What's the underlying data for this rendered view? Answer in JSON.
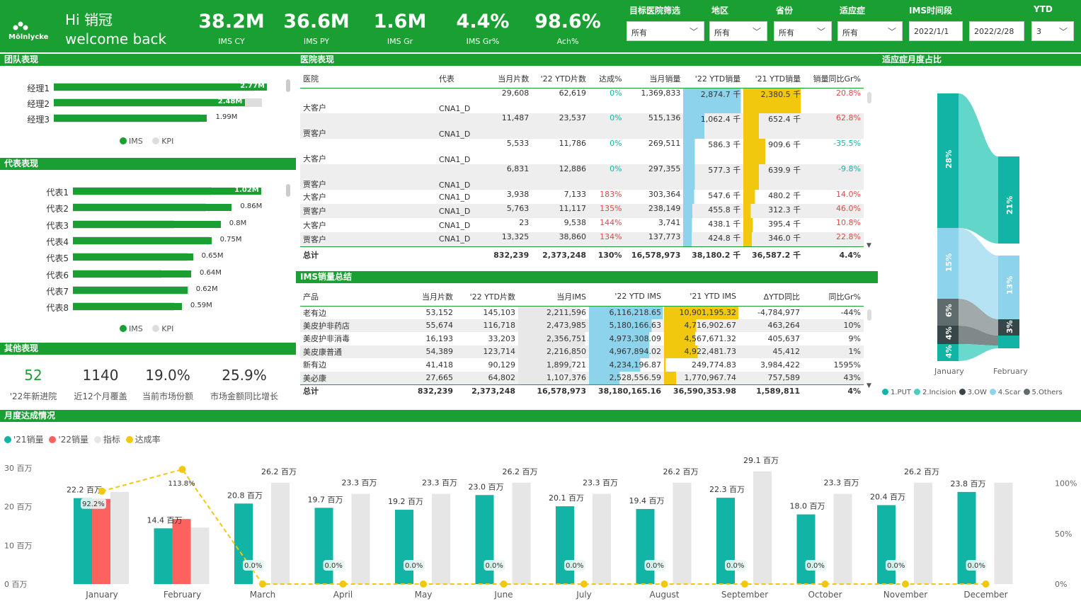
{
  "header": {
    "greeting": "Hi  销冠",
    "welcome": "welcome back",
    "logo_text": "Mölnlycke",
    "kpis": [
      {
        "value": "38.2M",
        "label": "IMS CY"
      },
      {
        "value": "36.6M",
        "label": "IMS PY"
      },
      {
        "value": "1.6M",
        "label": "IMS Gr"
      },
      {
        "value": "4.4%",
        "label": "IMS Gr%"
      },
      {
        "value": "98.6%",
        "label": "Ach%"
      }
    ],
    "filters": [
      {
        "label": "目标医院筛选",
        "value": "所有"
      },
      {
        "label": "地区",
        "value": "所有"
      },
      {
        "label": "省份",
        "value": "所有"
      },
      {
        "label": "适应症",
        "value": "所有"
      },
      {
        "label": "IMS时间段",
        "value": "2022/1/1",
        "value2": "2022/2/28"
      },
      {
        "label": "YTD",
        "value": "3"
      }
    ]
  },
  "sections": {
    "team": "团队表现",
    "rep": "代表表现",
    "other": "其他表现",
    "hospital": "医院表现",
    "ims": "IMS销量总结",
    "indication": "适应症月度占比",
    "monthly": "月度达成情况"
  },
  "team": {
    "legend": [
      "IMS",
      "KPI"
    ],
    "rows": [
      {
        "name": "经理1",
        "ims": 2.77,
        "kpi": 2.6,
        "label": "2.77M"
      },
      {
        "name": "经理2",
        "ims": 2.48,
        "kpi": 2.7,
        "label": "2.48M"
      },
      {
        "name": "经理3",
        "ims": 1.99,
        "kpi": 1.9,
        "label": "1.99M"
      }
    ]
  },
  "reps": {
    "legend": [
      "IMS",
      "KPI"
    ],
    "rows": [
      {
        "name": "代表1",
        "ims": 1.02,
        "kpi": 0.75,
        "label": "1.02M"
      },
      {
        "name": "代表2",
        "ims": 0.86,
        "kpi": 0.72,
        "label": "0.86M"
      },
      {
        "name": "代表3",
        "ims": 0.8,
        "kpi": 0.55,
        "label": "0.8M"
      },
      {
        "name": "代表4",
        "ims": 0.75,
        "kpi": 0.74,
        "label": "0.75M"
      },
      {
        "name": "代表5",
        "ims": 0.65,
        "kpi": 0.62,
        "label": "0.65M"
      },
      {
        "name": "代表6",
        "ims": 0.64,
        "kpi": 0.48,
        "label": "0.64M"
      },
      {
        "name": "代表7",
        "ims": 0.62,
        "kpi": 0.63,
        "label": "0.62M"
      },
      {
        "name": "代表8",
        "ims": 0.59,
        "kpi": 0.55,
        "label": "0.59M"
      }
    ]
  },
  "other": [
    {
      "value": "52",
      "label": "'22年新进院",
      "accent": "#1aa032"
    },
    {
      "value": "1140",
      "label": "近12个月覆盖"
    },
    {
      "value": "19.0%",
      "label": "当前市场份额"
    },
    {
      "value": "25.9%",
      "label": "市场金额同比增长"
    }
  ],
  "hospital": {
    "columns": [
      "医院",
      "代表",
      "当月片数",
      "'22 YTD片数",
      "达成%",
      "当月销量",
      "'22 YTD销量",
      "'21 YTD销量",
      "销量同比Gr%"
    ],
    "rows": [
      [
        "大客户",
        "CNA1_D",
        "29,608",
        "62,619",
        "0%",
        "1,369,833",
        "2,874.7 千",
        "2,380.5 千",
        "20.8%"
      ],
      [
        "贾客户",
        "CNA1_D",
        "11,487",
        "23,537",
        "0%",
        "515,136",
        "1,062.4 千",
        "652.4 千",
        "62.8%"
      ],
      [
        "大客户",
        "CNA1_D",
        "5,533",
        "11,786",
        "0%",
        "269,511",
        "586.3 千",
        "909.6 千",
        "-35.5%"
      ],
      [
        "贾客户",
        "CNA1_D",
        "6,831",
        "12,886",
        "0%",
        "297,355",
        "577.3 千",
        "639.9 千",
        "-9.8%"
      ],
      [
        "大客户",
        "CNA1_D",
        "3,938",
        "7,133",
        "183%",
        "303,364",
        "547.6 千",
        "480.2 千",
        "14.0%"
      ],
      [
        "贾客户",
        "CNA1_D",
        "5,763",
        "11,117",
        "135%",
        "238,149",
        "455.8 千",
        "312.3 千",
        "46.0%"
      ],
      [
        "大客户",
        "CNA1_D",
        "23",
        "9,538",
        "144%",
        "3,741",
        "438.1 千",
        "395.4 千",
        "10.8%"
      ],
      [
        "贾客户",
        "CNA1_D",
        "13,325",
        "38,860",
        "134%",
        "137,773",
        "424.8 千",
        "346.0 千",
        "22.8%"
      ]
    ],
    "bar22": [
      2874.7,
      1062.4,
      586.3,
      577.3,
      547.6,
      455.8,
      438.1,
      424.8
    ],
    "bar21": [
      2380.5,
      652.4,
      909.6,
      639.9,
      480.2,
      312.3,
      395.4,
      346.0
    ],
    "total": [
      "总计",
      "",
      "832,239",
      "2,373,248",
      "130%",
      "16,578,973",
      "38,180.2 千",
      "36,587.2 千",
      "4.4%"
    ]
  },
  "ims": {
    "columns": [
      "产品",
      "当月片数",
      "'22 YTD片数",
      "当月IMS",
      "'22 YTD IMS",
      "'21 YTD IMS",
      "ΔYTD同比",
      "同比Gr%"
    ],
    "rows": [
      [
        "老有边",
        "53,152",
        "145,103",
        "2,211,596",
        "6,116,218.65",
        "10,901,195.32",
        "-4,784,977",
        "-44%"
      ],
      [
        "美皮护非药店",
        "55,674",
        "116,718",
        "2,473,985",
        "5,180,166.63",
        "4,716,902.67",
        "463,264",
        "10%"
      ],
      [
        "美皮护非消毒",
        "16,193",
        "33,203",
        "2,356,751",
        "4,973,308.09",
        "4,567,671.32",
        "405,637",
        "9%"
      ],
      [
        "美皮康普通",
        "54,389",
        "123,714",
        "2,216,850",
        "4,967,894.02",
        "4,922,481.73",
        "45,412",
        "1%"
      ],
      [
        "新有边",
        "41,418",
        "90,129",
        "1,899,721",
        "4,234,196.87",
        "249,774.83",
        "3,984,422",
        "1595%"
      ],
      [
        "美必康",
        "27,665",
        "64,802",
        "1,107,376",
        "2,528,556.59",
        "1,770,967.74",
        "757,589",
        "43%"
      ]
    ],
    "bar_month": [
      2211596,
      2473985,
      2356751,
      2216850,
      1899721,
      1107376
    ],
    "bar22": [
      6116218.65,
      5180166.63,
      4973308.09,
      4967894.02,
      4234196.87,
      2528556.59
    ],
    "bar21": [
      10901195.32,
      4716902.67,
      4567671.32,
      4922481.73,
      249774.83,
      1770967.74
    ],
    "total": [
      "总计",
      "832,239",
      "2,373,248",
      "16,578,973",
      "38,180,165.16",
      "36,590,353.98",
      "1,589,811",
      "4%"
    ]
  },
  "indication": {
    "months": [
      "January",
      "February"
    ],
    "legend": [
      {
        "name": "1.PUT",
        "color": "#12b5a5"
      },
      {
        "name": "2.Incision",
        "color": "#45cfc0"
      },
      {
        "name": "3.OW",
        "color": "#374649"
      },
      {
        "name": "4.Scar",
        "color": "#8dd3ec"
      },
      {
        "name": "5.Others",
        "color": "#5f6b6d"
      }
    ],
    "jan_labels": [
      "28%",
      "15%",
      "6%",
      "4%",
      "4%"
    ],
    "feb_labels": [
      "21%",
      "13%",
      "3%"
    ]
  },
  "chart_data": {
    "type": "bar",
    "categories": [
      "January",
      "February",
      "March",
      "April",
      "May",
      "June",
      "July",
      "August",
      "September",
      "October",
      "November",
      "December"
    ],
    "series": [
      {
        "name": "'21销量",
        "color": "#12b5a5",
        "values": [
          22.2,
          14.4,
          20.8,
          19.7,
          19.2,
          23.0,
          20.1,
          19.4,
          22.3,
          18.0,
          20.4,
          23.8
        ]
      },
      {
        "name": "'22销量",
        "color": "#fd625e",
        "values": [
          22.0,
          16.8,
          null,
          null,
          null,
          null,
          null,
          null,
          null,
          null,
          null,
          null
        ]
      },
      {
        "name": "指标",
        "color": "#e6e6e6",
        "values": [
          23.8,
          14.6,
          26.2,
          23.3,
          23.3,
          26.2,
          23.3,
          26.2,
          29.1,
          23.3,
          26.2,
          26.2
        ]
      },
      {
        "name": "达成率",
        "color": "#f2c80f",
        "values": [
          92.2,
          113.8,
          0,
          0,
          0,
          0,
          0,
          0,
          0,
          0,
          0,
          0
        ]
      }
    ],
    "value_labels": [
      "22.2 百万",
      "14.4 百万",
      "20.8 百万",
      "19.7 百万",
      "19.2 百万",
      "23.0 百万",
      "20.1 百万",
      "19.4 百万",
      "22.3 百万",
      "18.0 百万",
      "20.4 百万",
      "23.8 百万"
    ],
    "target_labels": [
      "",
      "",
      "26.2 百万",
      "23.3 百万",
      "23.3 百万",
      "26.2 百万",
      "23.3 百万",
      "26.2 百万",
      "29.1 百万",
      "23.3 百万",
      "26.2 百万",
      ""
    ],
    "rate_labels": [
      "92.2%",
      "113.8%",
      "0.0%",
      "0.0%",
      "0.0%",
      "0.0%",
      "0.0%",
      "0.0%",
      "0.0%",
      "0.0%",
      "0.0%",
      "0.0%"
    ],
    "yaxis_left": [
      "30 百万",
      "20 百万",
      "10 百万",
      "0 百万"
    ],
    "yaxis_right": [
      "100%",
      "50%",
      "0%"
    ],
    "ylim": [
      0,
      30
    ],
    "y2lim": [
      0,
      130
    ]
  }
}
